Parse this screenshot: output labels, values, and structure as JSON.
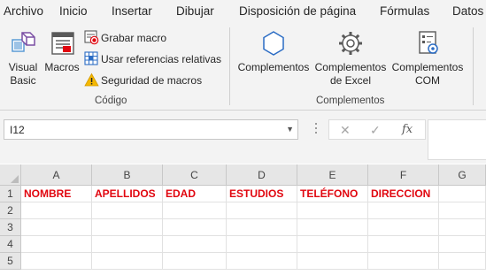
{
  "menu": {
    "tabs": [
      "Archivo",
      "Inicio",
      "Insertar",
      "Dibujar",
      "Disposición de página",
      "Fórmulas",
      "Datos"
    ]
  },
  "ribbon": {
    "codigo": {
      "visual_basic_line1": "Visual",
      "visual_basic_line2": "Basic",
      "macros": "Macros",
      "grabar_macro": "Grabar macro",
      "usar_referencias": "Usar referencias relativas",
      "seguridad_macros": "Seguridad de macros",
      "group_label": "Código"
    },
    "complementos": {
      "complementos": "Complementos",
      "excel_line1": "Complementos",
      "excel_line2": "de Excel",
      "com_line1": "Complementos",
      "com_line2": "COM",
      "group_label": "Complementos"
    }
  },
  "formula_bar": {
    "name_box": "I12",
    "cancel_symbol": "✕",
    "enter_symbol": "✓",
    "fx_symbol": "fx",
    "formula_value": ""
  },
  "sheet": {
    "columns": [
      "A",
      "B",
      "C",
      "D",
      "E",
      "F",
      "G"
    ],
    "rows": [
      "1",
      "2",
      "3",
      "4",
      "5"
    ],
    "row1": [
      "NOMBRE",
      "APELLIDOS",
      "EDAD",
      "ESTUDIOS",
      "TELÉFONO",
      "DIRECCION",
      ""
    ]
  },
  "colors": {
    "header_text": "#e1060f",
    "accent_blue": "#2b6cc4"
  }
}
